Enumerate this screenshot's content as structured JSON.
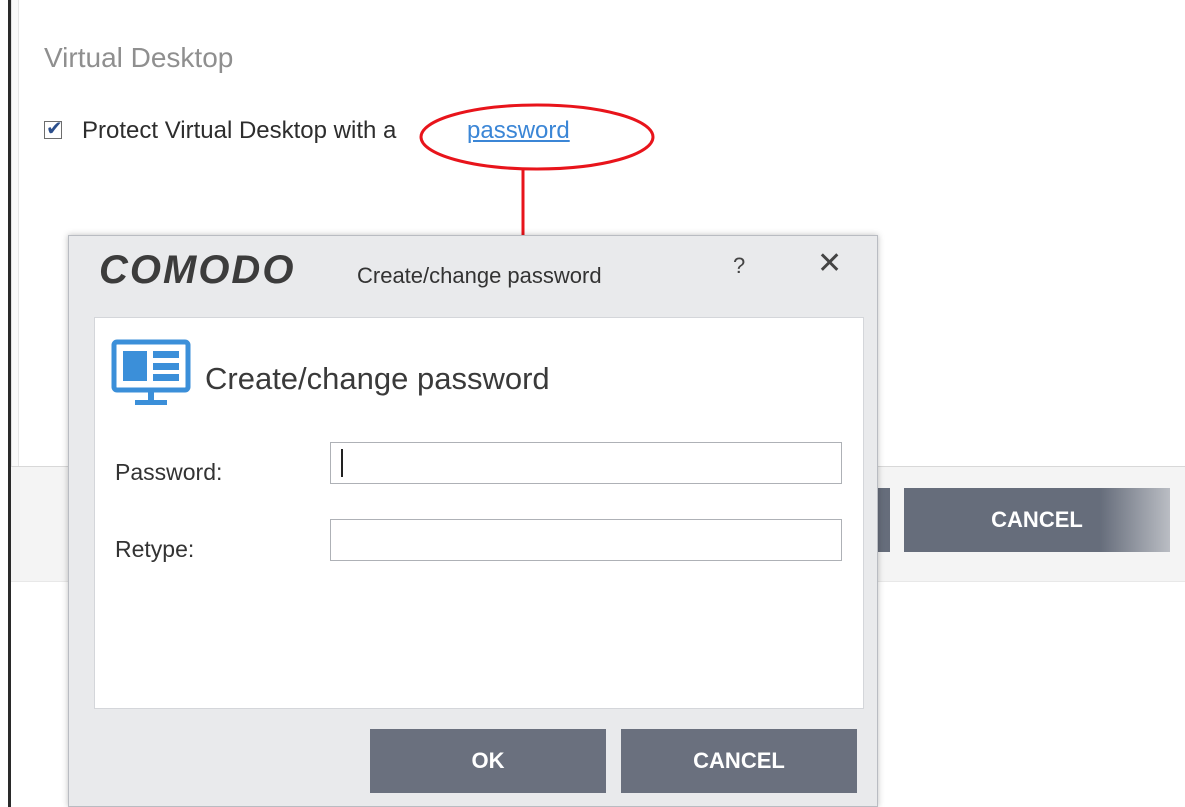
{
  "background": {
    "section_title": "Virtual Desktop",
    "checkbox_label": "Protect Virtual Desktop with a",
    "checkbox_checked": true,
    "password_link": "password",
    "cancel_button": "CANCEL"
  },
  "annotation": {
    "color": "#e8141b"
  },
  "dialog": {
    "logo": "COMODO",
    "title": "Create/change password",
    "help_label": "?",
    "close_label": "✕",
    "heading": "Create/change password",
    "icon": "monitor-icon",
    "accent_color": "#3b8fd9",
    "fields": {
      "password_label": "Password:",
      "password_value": "",
      "retype_label": "Retype:",
      "retype_value": ""
    },
    "ok_button": "OK",
    "cancel_button": "CANCEL"
  }
}
